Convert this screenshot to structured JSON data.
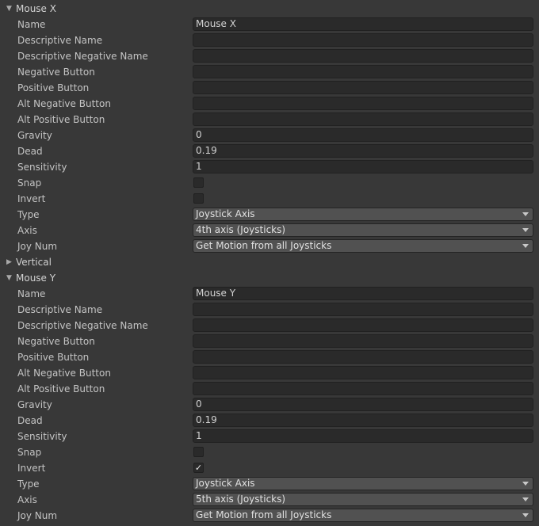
{
  "groups": [
    {
      "title": "Mouse X",
      "expanded": true,
      "foldout_icon": "triangle-down-icon",
      "fields": {
        "name_label": "Name",
        "name_value": "Mouse X",
        "descriptive_name_label": "Descriptive Name",
        "descriptive_name_value": "",
        "descriptive_negative_name_label": "Descriptive Negative Name",
        "descriptive_negative_name_value": "",
        "negative_button_label": "Negative Button",
        "negative_button_value": "",
        "positive_button_label": "Positive Button",
        "positive_button_value": "",
        "alt_negative_button_label": "Alt Negative Button",
        "alt_negative_button_value": "",
        "alt_positive_button_label": "Alt Positive Button",
        "alt_positive_button_value": "",
        "gravity_label": "Gravity",
        "gravity_value": "0",
        "dead_label": "Dead",
        "dead_value": "0.19",
        "sensitivity_label": "Sensitivity",
        "sensitivity_value": "1",
        "snap_label": "Snap",
        "snap_checked": false,
        "snap_mark": "",
        "invert_label": "Invert",
        "invert_checked": false,
        "invert_mark": "",
        "type_label": "Type",
        "type_value": "Joystick Axis",
        "axis_label": "Axis",
        "axis_value": "4th axis (Joysticks)",
        "joy_num_label": "Joy Num",
        "joy_num_value": "Get Motion from all Joysticks"
      }
    },
    {
      "title": "Vertical",
      "expanded": false,
      "foldout_icon": "triangle-right-icon"
    },
    {
      "title": "Mouse Y",
      "expanded": true,
      "foldout_icon": "triangle-down-icon",
      "fields": {
        "name_label": "Name",
        "name_value": "Mouse Y",
        "descriptive_name_label": "Descriptive Name",
        "descriptive_name_value": "",
        "descriptive_negative_name_label": "Descriptive Negative Name",
        "descriptive_negative_name_value": "",
        "negative_button_label": "Negative Button",
        "negative_button_value": "",
        "positive_button_label": "Positive Button",
        "positive_button_value": "",
        "alt_negative_button_label": "Alt Negative Button",
        "alt_negative_button_value": "",
        "alt_positive_button_label": "Alt Positive Button",
        "alt_positive_button_value": "",
        "gravity_label": "Gravity",
        "gravity_value": "0",
        "dead_label": "Dead",
        "dead_value": "0.19",
        "sensitivity_label": "Sensitivity",
        "sensitivity_value": "1",
        "snap_label": "Snap",
        "snap_checked": false,
        "snap_mark": "",
        "invert_label": "Invert",
        "invert_checked": true,
        "invert_mark": "✓",
        "type_label": "Type",
        "type_value": "Joystick Axis",
        "axis_label": "Axis",
        "axis_value": "5th axis (Joysticks)",
        "joy_num_label": "Joy Num",
        "joy_num_value": "Get Motion from all Joysticks"
      }
    }
  ],
  "icons": {
    "expanded": "triangle-down-icon",
    "collapsed": "triangle-right-icon",
    "dropdown": "dropdown-arrow-icon",
    "checkmark": "checkmark-icon"
  },
  "colors": {
    "background": "#383838",
    "field_background": "#2a2a2a",
    "dropdown_background": "#515151",
    "text": "#c4c4c4"
  }
}
